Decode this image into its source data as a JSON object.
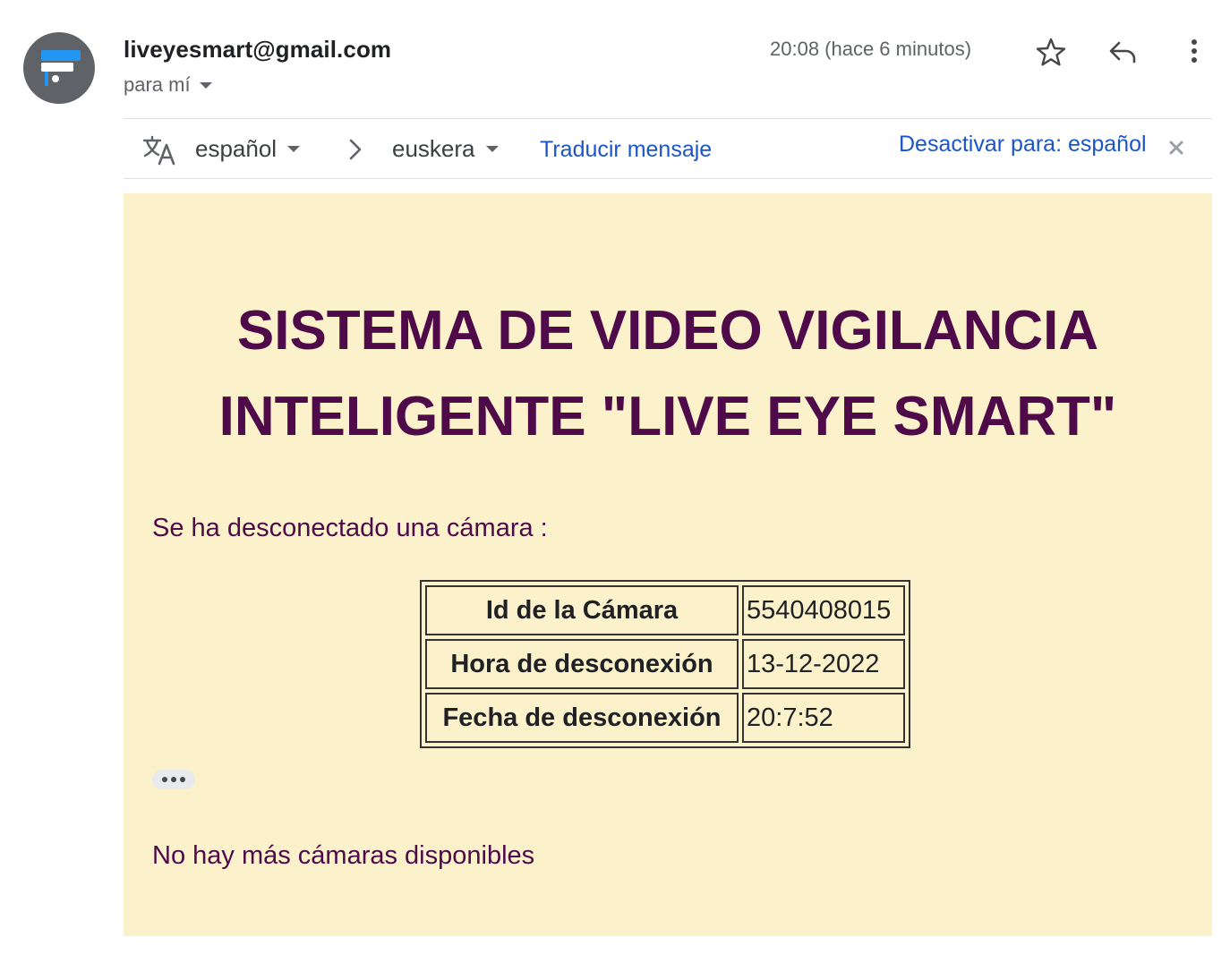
{
  "header": {
    "sender": "liveyesmart@gmail.com",
    "to": "para mí",
    "timestamp": "20:08 (hace 6 minutos)",
    "icons": [
      "camera-avatar-icon",
      "star-icon",
      "reply-icon",
      "more-vert-icon"
    ]
  },
  "translate_bar": {
    "source_lang": "español",
    "target_lang": "euskera",
    "translate_label": "Traducir mensaje",
    "disable_label": "Desactivar para: español",
    "icons": [
      "translate-icon",
      "chevron-right-icon",
      "close-icon"
    ]
  },
  "email": {
    "title_line1": "SISTEMA DE VIDEO VIGILANCIA",
    "title_line2": "INTELIGENTE \"LIVE EYE SMART\"",
    "message": "Se ha desconectado una cámara :",
    "table": [
      {
        "label": "Id de la Cámara",
        "value": "5540408015"
      },
      {
        "label": "Hora de desconexión",
        "value": "13-12-2022"
      },
      {
        "label": "Fecha de desconexión",
        "value": "20:7:52"
      }
    ],
    "footer": "No hay más cámaras disponibles"
  },
  "colors": {
    "body_bg": "#fbf1cb",
    "title_text": "#4f0a4a",
    "link": "#1a56c9",
    "avatar_bg": "#5f6368"
  }
}
